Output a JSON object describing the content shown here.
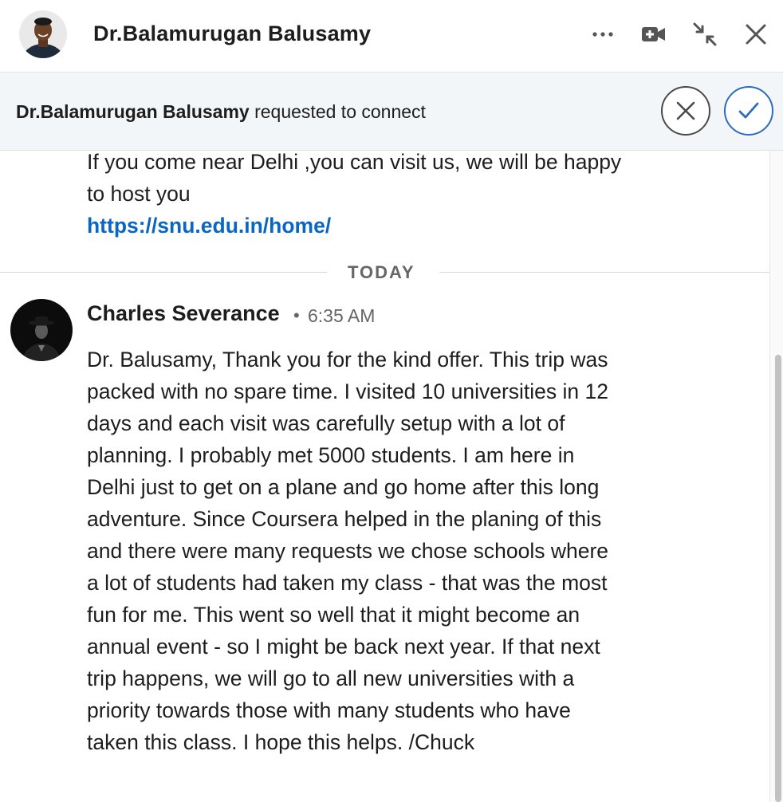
{
  "header": {
    "contact_name": "Dr.Balamurugan Balusamy",
    "icons": [
      "avatar",
      "more-icon",
      "video-call-icon",
      "minimize-icon",
      "close-icon"
    ]
  },
  "request": {
    "name": "Dr.Balamurugan Balusamy",
    "text": "requested to connect",
    "decline_icon": "x-icon",
    "accept_icon": "check-icon"
  },
  "previous_message": {
    "lines": [
      "If you come near Delhi ,you can visit us, we will be happy",
      "to host you"
    ],
    "link": "https://snu.edu.in/home/"
  },
  "divider": {
    "label": "TODAY"
  },
  "message": {
    "sender": "Charles Severance",
    "separator": "•",
    "time": "6:35 AM",
    "lines": [
      "Dr. Balusamy,  Thank you for the kind offer.  This trip was",
      "packed with no spare time.  I visited 10 universities in 12",
      "days and each visit was carefully setup with a lot of",
      "planning.  I probably met 5000 students.  I am here in",
      "Delhi just to get on a plane and go home after this long",
      "adventure.  Since Coursera helped in the planing of this",
      "and there were many requests we chose schools where",
      "a lot of students had taken my class - that was the most",
      "fun for me.  This went so well that it might become an",
      "annual event - so I might be back next year.   If that next",
      "trip happens, we will go to all new universities with a",
      "priority towards those with many students who have",
      "taken this class.   I hope this helps.  /Chuck"
    ]
  },
  "colors": {
    "link": "#0a66c2",
    "accept": "#2f6bbd",
    "request_bg": "#f3f6f8"
  }
}
